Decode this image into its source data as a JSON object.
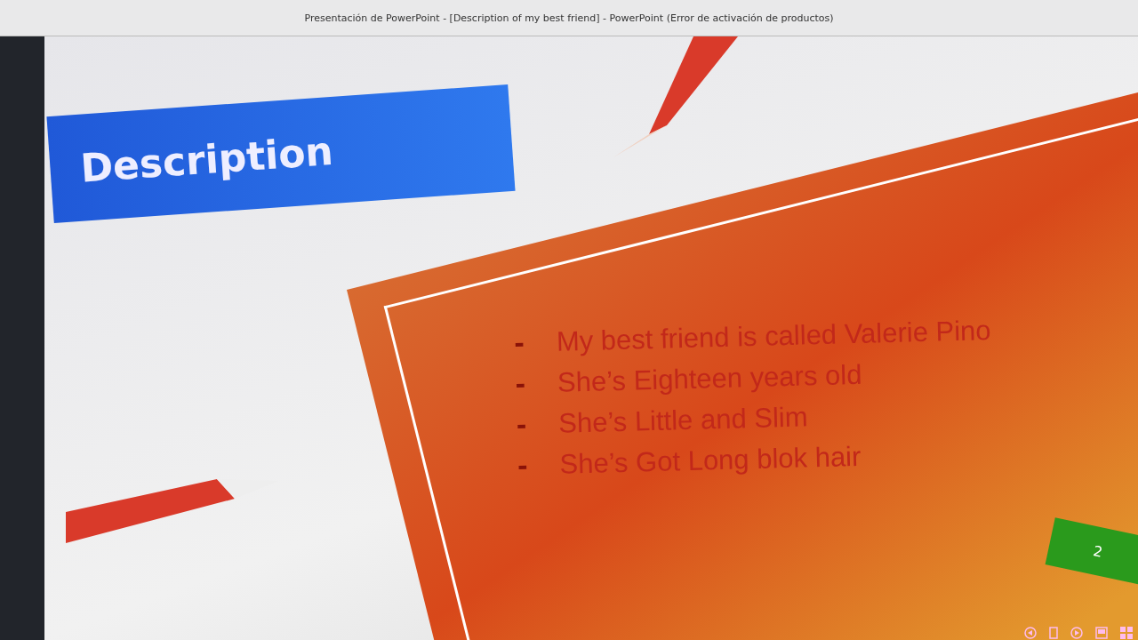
{
  "window": {
    "title": "Presentación de PowerPoint - [Description of my best friend] - PowerPoint (Error de activación de productos)"
  },
  "slide": {
    "title": "Description",
    "bullets": [
      {
        "marker": "-",
        "text": "My best friend is called Valerie Pino"
      },
      {
        "marker": "-",
        "text": "She’s Eighteen years old"
      },
      {
        "marker": "-",
        "text": "She’s Little and Slim"
      },
      {
        "marker": "-",
        "text": "She’s Got Long blok hair"
      }
    ],
    "slide_number": "2"
  }
}
